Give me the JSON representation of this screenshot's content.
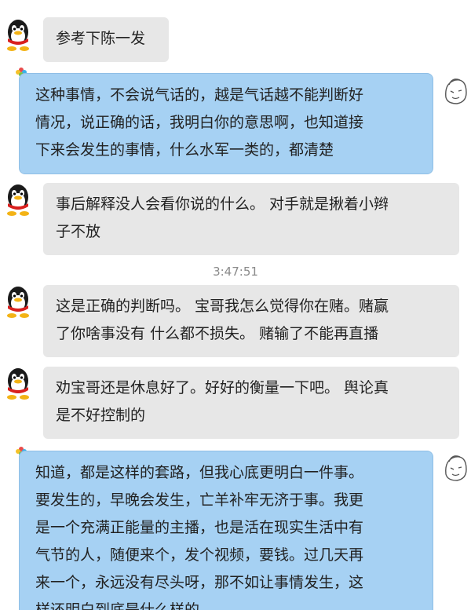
{
  "messages": [
    {
      "sender": "contact",
      "avatar_icon": "qq-penguin-icon",
      "lines": [
        "参考下陈一发"
      ]
    },
    {
      "sender": "self",
      "avatar_icon": "user-sketch-icon",
      "badge_icon": "flower-icon",
      "lines": [
        "这种事情，不会说气话的，越是气话越不能判断好",
        "情况，说正确的话，我明白你的意思啊，也知道接",
        "下来会发生的事情，什么水军一类的，都清楚"
      ]
    },
    {
      "sender": "contact",
      "avatar_icon": "qq-penguin-icon",
      "lines": [
        "事后解释没人会看你说的什么。 对手就是揪着小辫",
        "子不放"
      ]
    },
    {
      "sender": "contact",
      "avatar_icon": "qq-penguin-icon",
      "lines": [
        "这是正确的判断吗。  宝哥我怎么觉得你在赌。赌赢",
        "了你啥事没有 什么都不损失。 赌输了不能再直播"
      ]
    },
    {
      "sender": "contact",
      "avatar_icon": "qq-penguin-icon",
      "lines": [
        "劝宝哥还是休息好了。好好的衡量一下吧。 舆论真",
        "是不好控制的"
      ]
    },
    {
      "sender": "self",
      "avatar_icon": "user-sketch-icon",
      "badge_icon": "flower-icon",
      "lines": [
        "知道，都是这样的套路，但我心底更明白一件事。",
        "要发生的，早晚会发生，亡羊补牢无济于事。我更",
        "是一个充满正能量的主播，也是活在现实生活中有",
        "气节的人，随便来个，发个视频，要钱。过几天再",
        "来一个，永远没有尽头呀，那不如让事情发生，这",
        "样还明白到底是什么样的"
      ]
    }
  ],
  "timestamp": "3:47:51",
  "colors": {
    "incoming_bubble": "#e7e7e7",
    "outgoing_bubble": "#a6d1f3",
    "timestamp_text": "#8a8a8a"
  }
}
